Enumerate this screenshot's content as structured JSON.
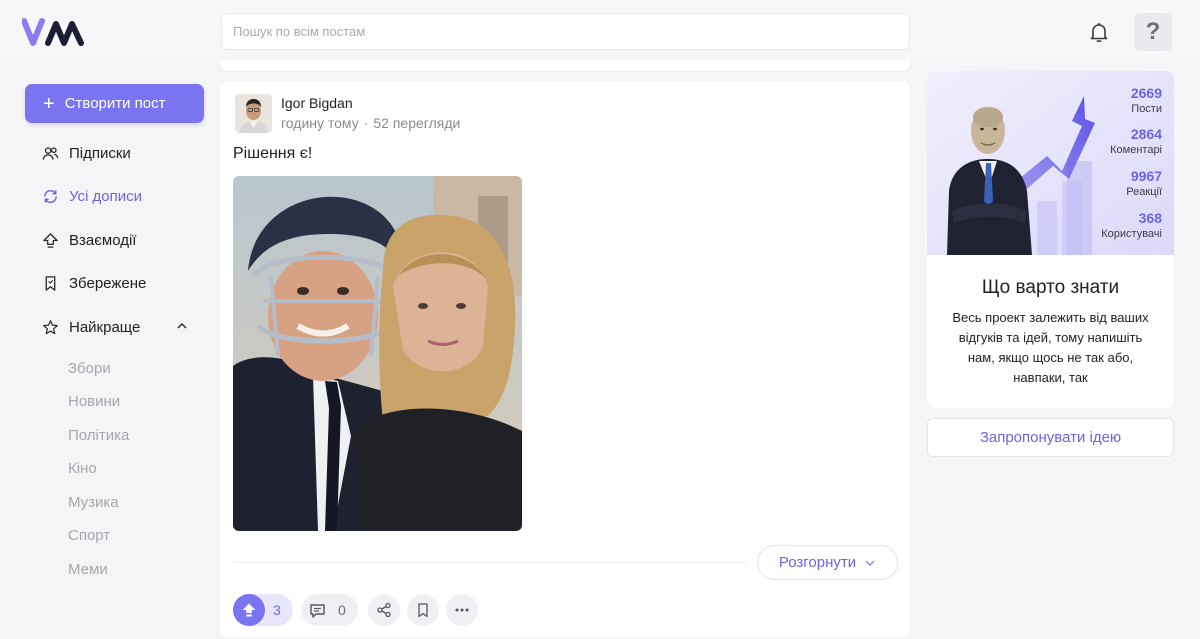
{
  "header": {
    "search_placeholder": "Пошук по всім постам"
  },
  "sidebar": {
    "create_label": "Створити пост",
    "items": [
      {
        "label": "Підписки",
        "icon": "users-icon"
      },
      {
        "label": "Усі дописи",
        "icon": "refresh-icon",
        "active": true
      },
      {
        "label": "Взаємодії",
        "icon": "interactions-icon"
      },
      {
        "label": "Збережене",
        "icon": "bookmark-icon"
      },
      {
        "label": "Найкраще",
        "icon": "star-icon"
      }
    ],
    "subitems": [
      "Збори",
      "Новини",
      "Політика",
      "Кіно",
      "Музика",
      "Спорт",
      "Меми"
    ]
  },
  "post": {
    "author": "Igor Bigdan",
    "time": "годину тому",
    "views": "52 перегляди",
    "text": "Рішення є!",
    "expand_label": "Розгорнути",
    "likes": "3",
    "comments": "0"
  },
  "info": {
    "stats": [
      {
        "value": "2669",
        "label": "Пости"
      },
      {
        "value": "2864",
        "label": "Коментарі"
      },
      {
        "value": "9967",
        "label": "Реакції"
      },
      {
        "value": "368",
        "label": "Користувачі"
      }
    ],
    "title": "Що варто знати",
    "text": "Весь проект залежить від ваших відгуків та ідей, тому напишіть нам, якщо щось не так або, навпаки, так",
    "idea_label": "Запропонувати ідею"
  },
  "colors": {
    "accent": "#7b74f0",
    "accent_text": "#6d63e8"
  }
}
